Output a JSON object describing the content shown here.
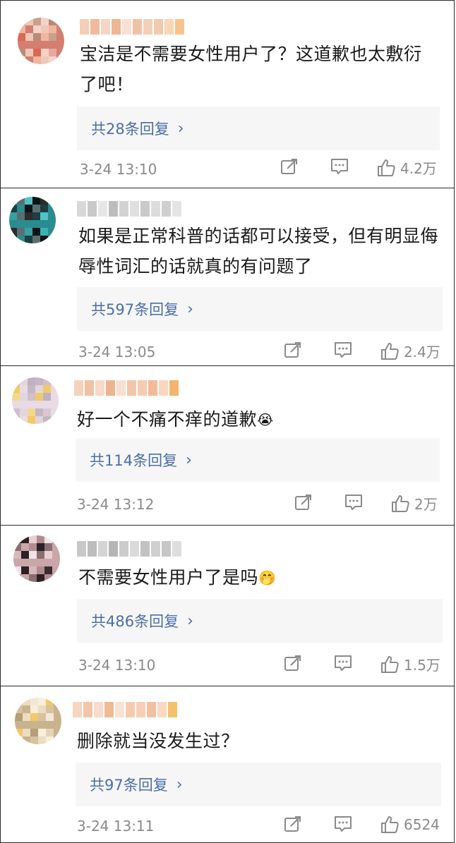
{
  "comments": [
    {
      "username": "",
      "text": "宝洁是不需要女性用户了？这道歉也太敷衍了吧！",
      "reply_label": "共28条回复",
      "time": "3-24 13:10",
      "likes": "4.2万",
      "avatar_palette": [
        "#e8a7a0",
        "#d37e6f",
        "#c9a08b",
        "#f0b59e",
        "#b98b7a",
        "#eec7b8",
        "#d9694f",
        "#f4d3c8"
      ],
      "name_palette": [
        "#f6cdb6",
        "#f2b99a",
        "#f5d6c7",
        "#eeb693",
        "#f8e1d4",
        "#f1c1a6",
        "#f5d0b9",
        "#f3c9ae",
        "#fad6b4",
        "#f7c48c"
      ]
    },
    {
      "username": "",
      "text": "如果是正常科普的话都可以接受，但有明显侮辱性词汇的话就真的有问题了",
      "reply_label": "共597条回复",
      "time": "3-24 13:05",
      "likes": "2.4万",
      "avatar_palette": [
        "#3ab2b5",
        "#2a8c8f",
        "#4fc4c7",
        "#1d3e40",
        "#2b2b2b",
        "#5a6e70",
        "#37a0a3",
        "#0e1414"
      ],
      "name_palette": [
        "#d8d8d8",
        "#c9c9c9",
        "#e6e6e6",
        "#bdbdbd",
        "#d2d2d2",
        "#e0e0e0",
        "#cacaca",
        "#dcdcdc",
        "#cfcfcf",
        "#e4e4e4"
      ]
    },
    {
      "username": "",
      "text": "好一个不痛不痒的道歉",
      "emoji": "😭",
      "reply_label": "共114条回复",
      "time": "3-24 13:12",
      "likes": "2万",
      "avatar_palette": [
        "#d9c8d4",
        "#e8dbe5",
        "#bfb0c4",
        "#f1c96a",
        "#cfc0cc",
        "#e2d6de",
        "#f3d98a",
        "#c4b6c2"
      ],
      "name_palette": [
        "#f6d2bc",
        "#f2c1a4",
        "#f7d9c6",
        "#efb38f",
        "#f8dfcf",
        "#f3c6aa",
        "#f6cbb1",
        "#f2bb98",
        "#f9d7bf",
        "#f6b46e"
      ]
    },
    {
      "username": "",
      "text": "不需要女性用户了是吗",
      "emoji": "🤭",
      "reply_label": "共486条回复",
      "time": "3-24 13:10",
      "likes": "1.5万",
      "avatar_palette": [
        "#3a2c30",
        "#caa6a8",
        "#e6d0d2",
        "#8a6e72",
        "#f0e4e6",
        "#2b2024",
        "#d9b8ba",
        "#b08c90"
      ],
      "name_palette": [
        "#c8c8c8",
        "#bdbdbd",
        "#d4d4d4",
        "#b5b5b5",
        "#cccccc",
        "#dadada",
        "#c2c2c2",
        "#d0d0d0",
        "#c6c6c6",
        "#dedede"
      ]
    },
    {
      "username": "",
      "text": "删除就当没发生过？",
      "reply_label": "共97条回复",
      "time": "3-24 13:11",
      "likes": "6524",
      "avatar_palette": [
        "#e2d4bc",
        "#c9b38f",
        "#f1e8d8",
        "#d6c29e",
        "#f4c76a",
        "#ebdcc2",
        "#b79e78",
        "#f9efd9"
      ],
      "name_palette": [
        "#f6d6bd",
        "#f2c6a6",
        "#f8dccb",
        "#f0ba95",
        "#f8e2d2",
        "#f4cbaf",
        "#f6d0b6",
        "#f2c09e",
        "#f9d9c1",
        "#f4c06c"
      ]
    }
  ],
  "icons": {
    "repost": "repost-icon",
    "comment": "comment-icon",
    "like": "like-icon"
  }
}
